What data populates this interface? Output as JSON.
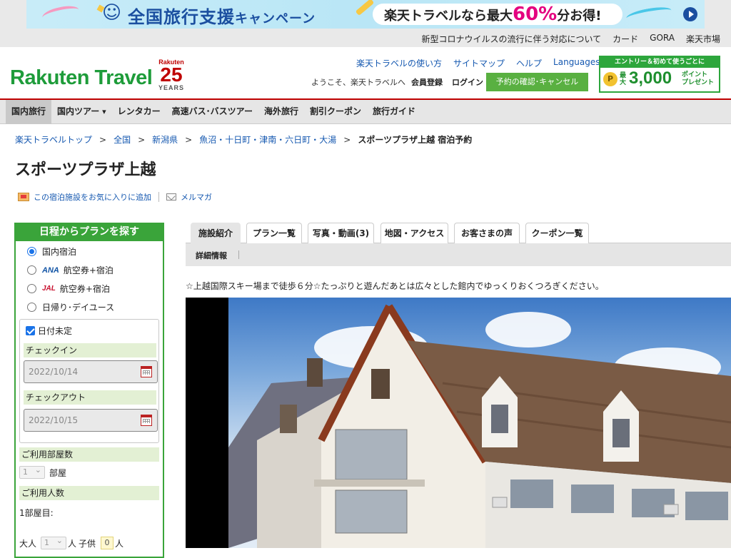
{
  "promo": {
    "title_main": "全国旅行支援",
    "title_sub": "キャンペーン",
    "pill_text_before": "楽天トラベルなら最大",
    "pill_pct": "60%",
    "pill_text_after": "分お得!"
  },
  "utility_links": [
    "新型コロナウイルスの流行に伴う対応について",
    "カード",
    "GORA",
    "楽天市場"
  ],
  "header": {
    "logo_text": "Rakuten Travel",
    "anniv_brand": "Rakuten",
    "anniv_num": "25",
    "anniv_years": "YEARS",
    "links": [
      "楽天トラベルの使い方",
      "サイトマップ",
      "ヘルプ",
      "Languages"
    ],
    "welcome": "ようこそ、楽天トラベルへ",
    "signup": "会員登録",
    "login": "ログイン",
    "reserve_button": "予約の確認･キャンセル",
    "entry_banner_head": "エントリー＆初めて使うごとに",
    "entry_coin": "P",
    "entry_pre": "最大",
    "entry_amount": "3,000",
    "entry_unit_1": "ポイント",
    "entry_unit_2": "プレゼント"
  },
  "gnav": [
    "国内旅行",
    "国内ツアー",
    "レンタカー",
    "高速バス･バスツアー",
    "海外旅行",
    "割引クーポン",
    "旅行ガイド"
  ],
  "breadcrumb": {
    "items": [
      "楽天トラベルトップ",
      "全国",
      "新潟県",
      "魚沼・十日町・津南・六日町・大湯"
    ],
    "current": "スポーツプラザ上越 宿泊予約",
    "separator": ">"
  },
  "hotel_name": "スポーツプラザ上越",
  "actions": {
    "favorite": "この宿泊施設をお気に入りに追加",
    "mailmag": "メルマガ"
  },
  "sidebar": {
    "title": "日程からプランを探す",
    "options": [
      "国内宿泊",
      "航空券+宿泊",
      "航空券+宿泊",
      "日帰り･デイユース"
    ],
    "ana": "ANA",
    "jal": "JAL",
    "undecided": "日付未定",
    "checkin_label": "チェックイン",
    "checkin_value": "2022/10/14",
    "checkout_label": "チェックアウト",
    "checkout_value": "2022/10/15",
    "rooms_label": "ご利用部屋数",
    "rooms_value": "1",
    "rooms_unit": "部屋",
    "guests_label": "ご利用人数",
    "room1_label": "1部屋目:",
    "adult_label": "大人",
    "adult_value": "1",
    "person_unit": "人",
    "child_label": "子供",
    "child_value": "0",
    "child_unit": "人"
  },
  "tabs": [
    "施設紹介",
    "プラン一覧",
    "写真・動画(3)",
    "地図・アクセス",
    "お客さまの声",
    "クーポン一覧"
  ],
  "subtab": "詳細情報",
  "catchphrase": "☆上越国際スキー場まで徒歩６分☆たっぷりと遊んだあとは広々とした館内でゆっくりおくつろぎください。"
}
